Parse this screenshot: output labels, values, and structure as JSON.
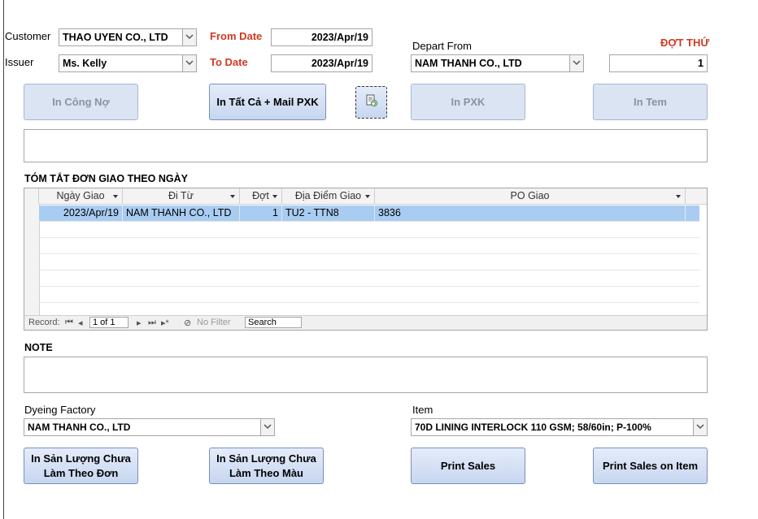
{
  "form": {
    "customer_label": "Customer",
    "customer_value": "THAO UYEN CO., LTD",
    "issuer_label": "Issuer",
    "issuer_value": "Ms. Kelly",
    "from_date_label": "From Date",
    "from_date_value": "2023/Apr/19",
    "to_date_label": "To Date",
    "to_date_value": "2023/Apr/19",
    "depart_from_label": "Depart From",
    "depart_from_value": "NAM THANH CO., LTD",
    "dot_thu_label": "ĐỢT THỨ",
    "dot_thu_value": "1"
  },
  "buttons": {
    "in_cong_no": "In Công Nợ",
    "in_tat_ca_mail": "In Tất Cả + Mail PXK",
    "in_pxk": "In PXK",
    "in_tem": "In Tem",
    "in_san_luong_don_line1": "In Sản Lượng Chưa",
    "in_san_luong_don_line2": "Làm Theo Đơn",
    "in_san_luong_mau_line1": "In Sản Lượng Chưa",
    "in_san_luong_mau_line2": "Làm Theo Màu",
    "print_sales": "Print Sales",
    "print_sales_on_item": "Print Sales on Item"
  },
  "summary": {
    "title": "TÓM TẮT ĐƠN GIAO THEO NGÀY",
    "columns": [
      "Ngày Giao",
      "Đi Từ",
      "Đợt",
      "Địa Điểm Giao",
      "PO Giao"
    ],
    "rows": [
      {
        "ngay_giao": "2023/Apr/19",
        "di_tu": "NAM THANH CO., LTD",
        "dot": "1",
        "dia_diem": "TU2 - TTN8",
        "po": "3836"
      }
    ],
    "nav": {
      "record_label": "Record:",
      "position": "1 of 1",
      "filter": "No Filter",
      "search": "Search"
    }
  },
  "note": {
    "label": "NOTE",
    "value": ""
  },
  "dyeing": {
    "label": "Dyeing Factory",
    "value": "NAM THANH CO., LTD"
  },
  "item": {
    "label": "Item",
    "value": "70D LINING INTERLOCK 110 GSM; 58/60in; P-100%"
  },
  "icons": {
    "dropdown": "chevron-down-icon",
    "refresh": "refresh-doc-icon"
  }
}
